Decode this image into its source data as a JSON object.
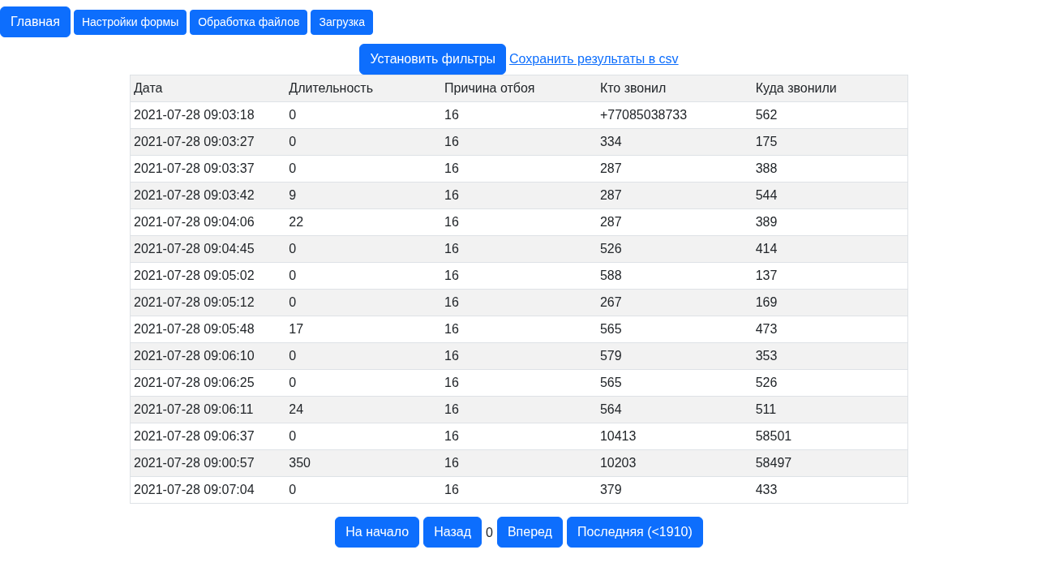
{
  "nav": [
    {
      "label": "Главная",
      "selected": true
    },
    {
      "label": "Настройки формы",
      "selected": false
    },
    {
      "label": "Обработка файлов",
      "selected": false
    },
    {
      "label": "Загрузка",
      "selected": false
    }
  ],
  "filters": {
    "button": "Установить фильтры",
    "csv_link": "Сохранить результаты в csv"
  },
  "table": {
    "columns": [
      "Дата",
      "Длительность",
      "Причина отбоя",
      "Кто звонил",
      "Куда звонили"
    ],
    "rows": [
      [
        "2021-07-28 09:03:18",
        "0",
        "16",
        "+77085038733",
        "562"
      ],
      [
        "2021-07-28 09:03:27",
        "0",
        "16",
        "334",
        "175"
      ],
      [
        "2021-07-28 09:03:37",
        "0",
        "16",
        "287",
        "388"
      ],
      [
        "2021-07-28 09:03:42",
        "9",
        "16",
        "287",
        "544"
      ],
      [
        "2021-07-28 09:04:06",
        "22",
        "16",
        "287",
        "389"
      ],
      [
        "2021-07-28 09:04:45",
        "0",
        "16",
        "526",
        "414"
      ],
      [
        "2021-07-28 09:05:02",
        "0",
        "16",
        "588",
        "137"
      ],
      [
        "2021-07-28 09:05:12",
        "0",
        "16",
        "267",
        "169"
      ],
      [
        "2021-07-28 09:05:48",
        "17",
        "16",
        "565",
        "473"
      ],
      [
        "2021-07-28 09:06:10",
        "0",
        "16",
        "579",
        "353"
      ],
      [
        "2021-07-28 09:06:25",
        "0",
        "16",
        "565",
        "526"
      ],
      [
        "2021-07-28 09:06:11",
        "24",
        "16",
        "564",
        "511"
      ],
      [
        "2021-07-28 09:06:37",
        "0",
        "16",
        "10413",
        "58501"
      ],
      [
        "2021-07-28 09:00:57",
        "350",
        "16",
        "10203",
        "58497"
      ],
      [
        "2021-07-28 09:07:04",
        "0",
        "16",
        "379",
        "433"
      ]
    ]
  },
  "pagination": {
    "first": "На начало",
    "prev": "Назад",
    "page": "0",
    "next": "Вперед",
    "last": "Последняя (<1910)"
  }
}
